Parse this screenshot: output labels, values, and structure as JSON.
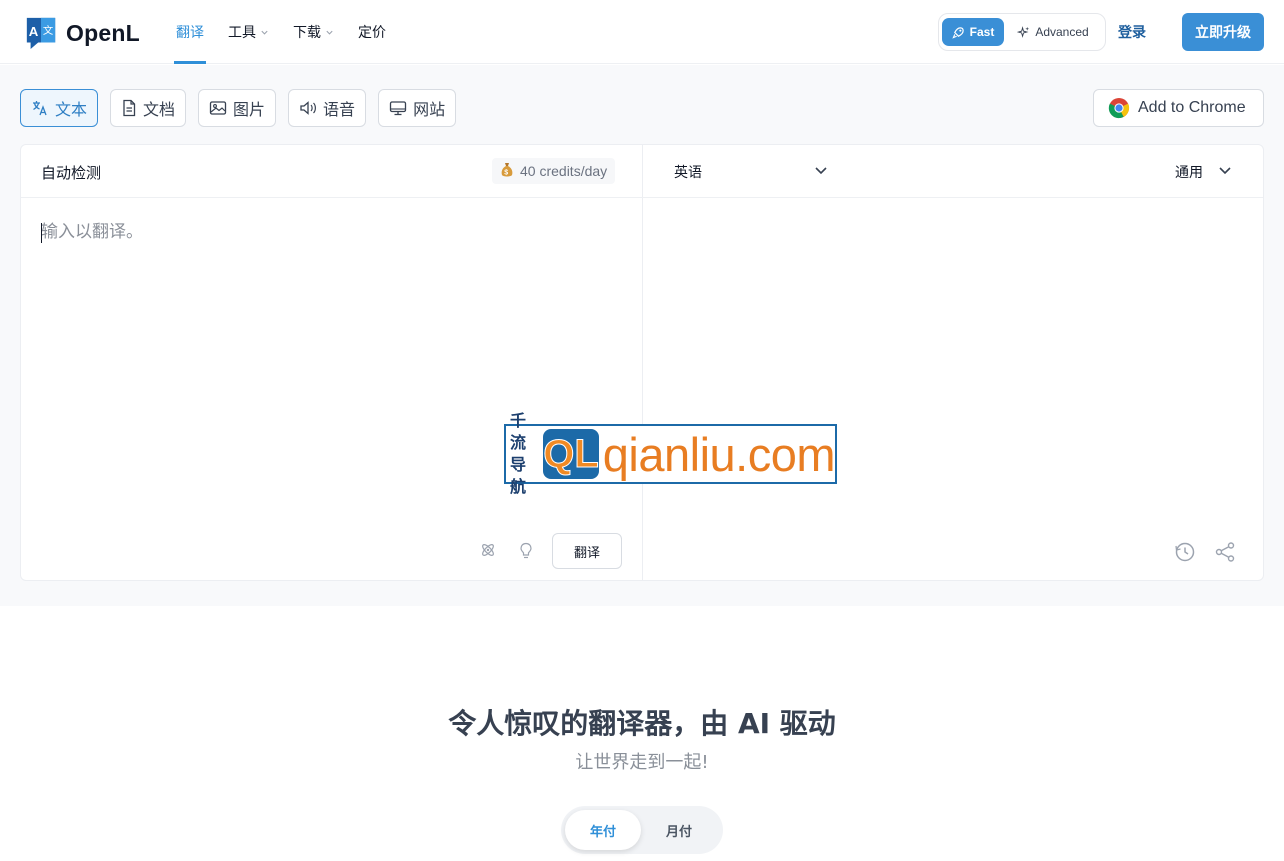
{
  "header": {
    "brand": "OpenL",
    "nav": [
      {
        "label": "翻译",
        "active": true,
        "dropdown": false
      },
      {
        "label": "工具",
        "active": false,
        "dropdown": true
      },
      {
        "label": "下载",
        "active": false,
        "dropdown": true
      },
      {
        "label": "定价",
        "active": false,
        "dropdown": false
      }
    ],
    "mode_fast": "Fast",
    "mode_advanced": "Advanced",
    "login": "登录",
    "upgrade": "立即升级"
  },
  "tabs": [
    {
      "label": "文本",
      "icon": "translate-icon",
      "active": true
    },
    {
      "label": "文档",
      "icon": "document-icon",
      "active": false
    },
    {
      "label": "图片",
      "icon": "image-icon",
      "active": false
    },
    {
      "label": "语音",
      "icon": "speaker-icon",
      "active": false
    },
    {
      "label": "网站",
      "icon": "monitor-icon",
      "active": false
    }
  ],
  "add_to_chrome": "Add to Chrome",
  "translator": {
    "source_lang": "自动检测",
    "credits": "40 credits/day",
    "target_lang": "英语",
    "tone": "通用",
    "placeholder": "输入以翻译。",
    "translate_button": "翻译"
  },
  "watermark": {
    "line1": "千流",
    "line2": "导航",
    "mark": "QL",
    "domain": "qianliu.com"
  },
  "hero": {
    "title": "令人惊叹的翻译器，由 AI 驱动",
    "subtitle": "让世界走到一起!"
  },
  "billing": {
    "yearly": "年付",
    "monthly": "月付"
  },
  "colors": {
    "accent": "#3a8fd6",
    "brand_dark": "#1e5f9e"
  }
}
